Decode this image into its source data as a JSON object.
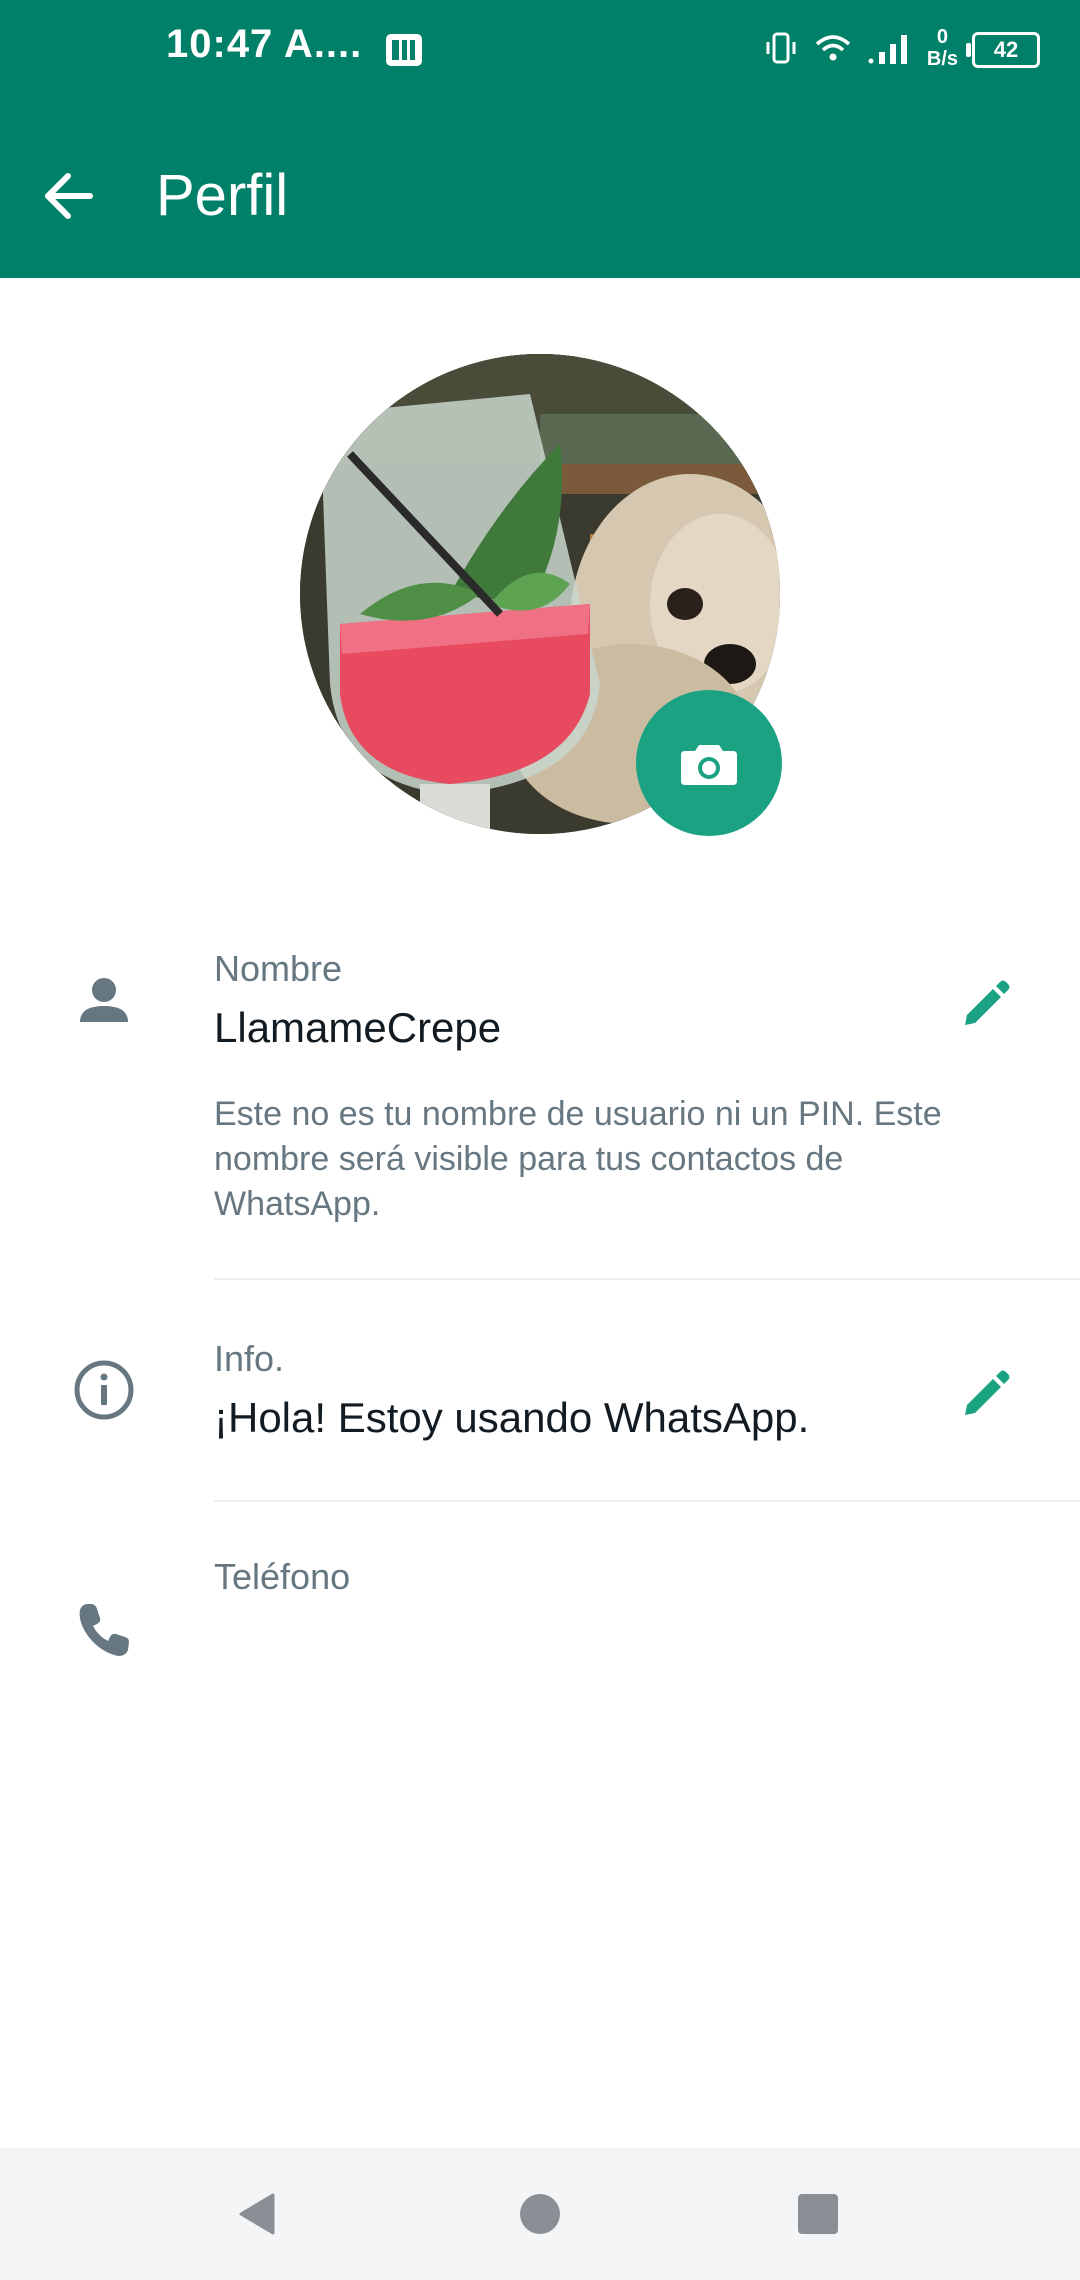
{
  "status_bar": {
    "time": "10:47 A....",
    "net_speed_value": "0",
    "net_speed_unit": "B/s",
    "battery": "42"
  },
  "app_bar": {
    "title": "Perfil"
  },
  "profile": {
    "name_label": "Nombre",
    "name_value": "LlamameCrepe",
    "name_hint": "Este no es tu nombre de usuario ni un PIN. Este nombre será visible para tus contactos de WhatsApp.",
    "info_label": "Info.",
    "info_value": "¡Hola! Estoy usando WhatsApp.",
    "phone_label": "Teléfono",
    "phone_value": ""
  },
  "colors": {
    "brand_green": "#008069",
    "camera_button": "#1aa283",
    "icon_grey": "#667781",
    "edit_icon": "#1aa283"
  },
  "icons": {
    "back": "arrow-left",
    "camera": "camera",
    "name": "person",
    "info": "info-circle",
    "phone": "phone",
    "edit": "pencil",
    "nav_back": "triangle-back",
    "nav_home": "circle-home",
    "nav_recents": "square-recents"
  }
}
